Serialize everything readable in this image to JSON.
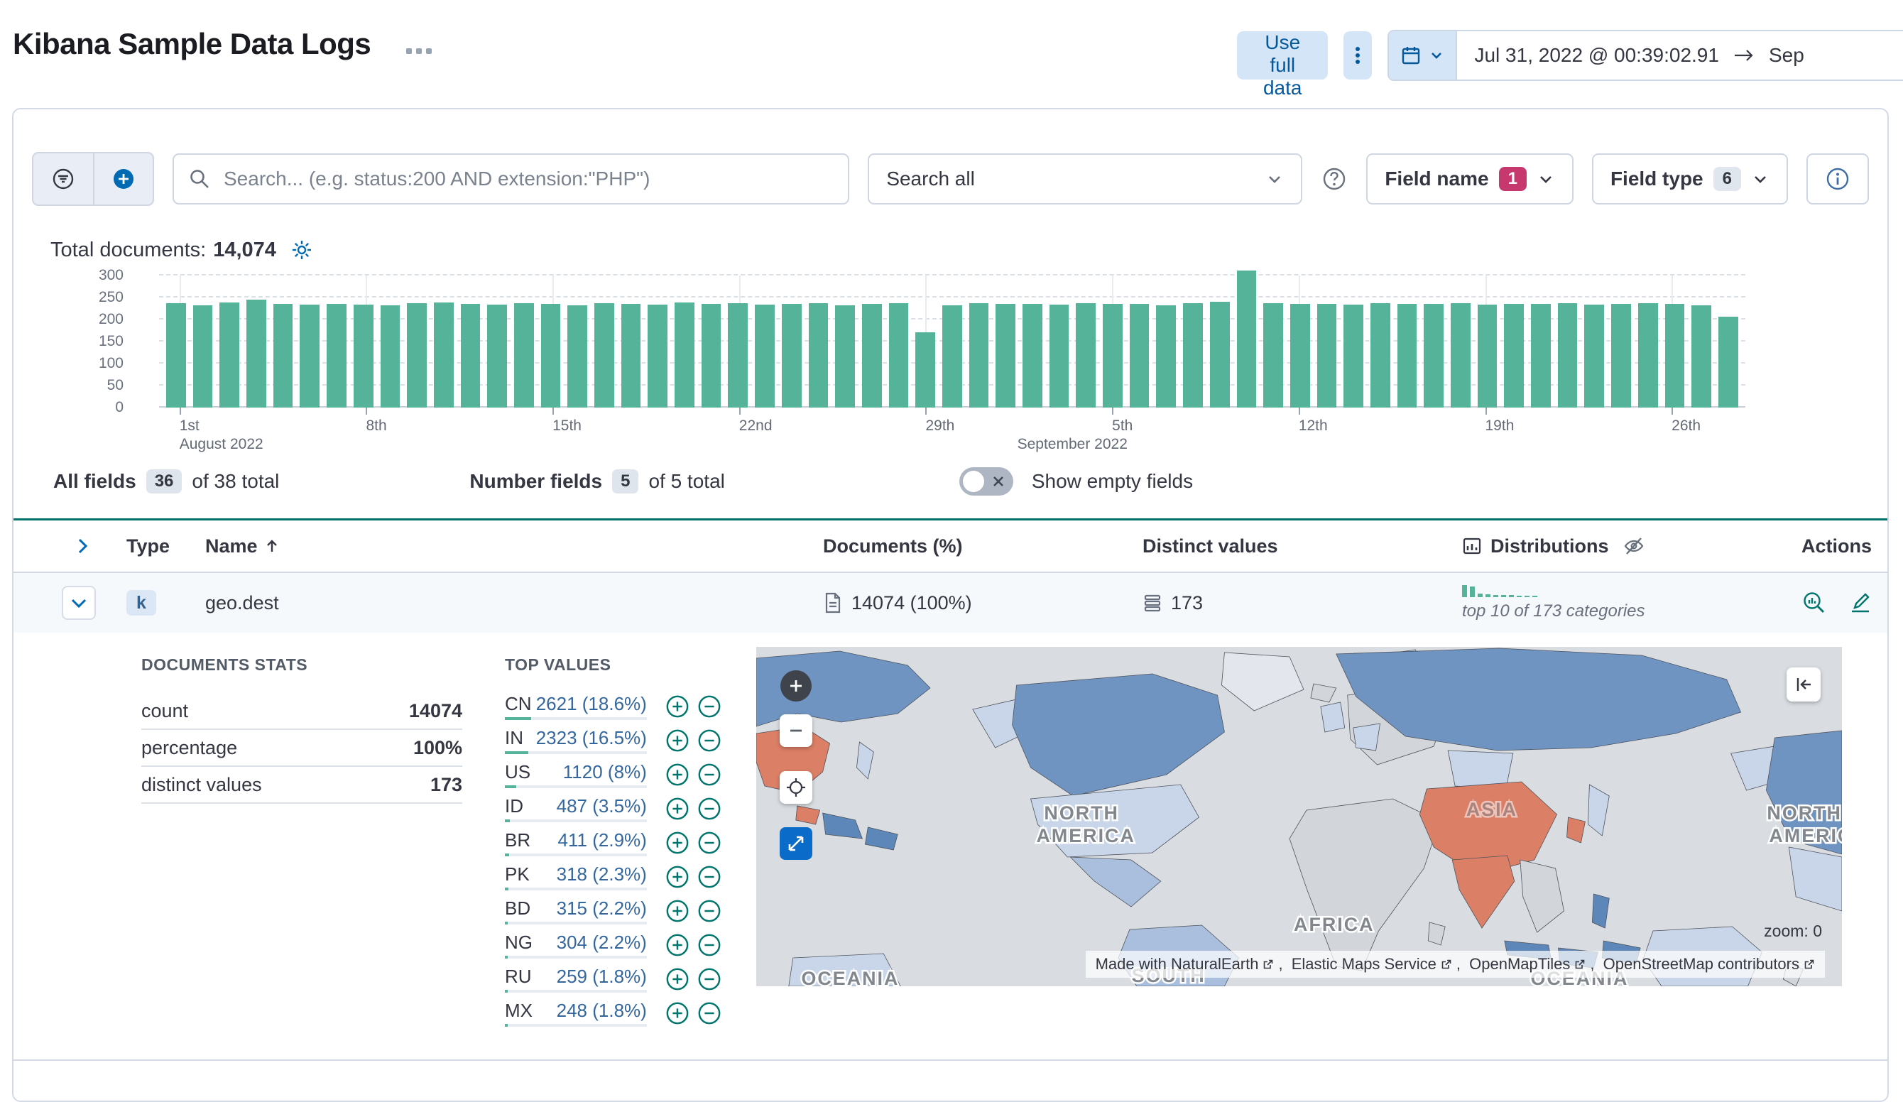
{
  "header": {
    "title": "Kibana Sample Data Logs",
    "use_full_data": "Use full data",
    "date_start": "Jul 31, 2022 @ 00:39:02.91",
    "date_end": "Sep"
  },
  "toolbar": {
    "search_placeholder": "Search... (e.g. status:200 AND extension:\"PHP\")",
    "search_all": "Search all",
    "field_name_label": "Field name",
    "field_name_count": "1",
    "field_type_label": "Field type",
    "field_type_count": "6"
  },
  "summary": {
    "total_documents_label": "Total documents:",
    "total_documents_value": "14,074"
  },
  "chart_data": {
    "type": "bar",
    "ylim": [
      0,
      300
    ],
    "yticks": [
      0,
      50,
      100,
      150,
      200,
      250,
      300
    ],
    "grid": true,
    "bar_color": "#54b399",
    "xticks": [
      {
        "i": 0,
        "label": "1st",
        "sub": "August 2022"
      },
      {
        "i": 7,
        "label": "8th"
      },
      {
        "i": 14,
        "label": "15th"
      },
      {
        "i": 21,
        "label": "22nd"
      },
      {
        "i": 28,
        "label": "29th"
      },
      {
        "i": 35,
        "label": "5th",
        "sub": "September 2022",
        "sub_align": "right"
      },
      {
        "i": 42,
        "label": "12th"
      },
      {
        "i": 49,
        "label": "19th"
      },
      {
        "i": 56,
        "label": "26th"
      }
    ],
    "values": [
      237,
      233,
      238,
      245,
      236,
      234,
      236,
      234,
      233,
      237,
      238,
      235,
      234,
      237,
      236,
      233,
      237,
      235,
      234,
      238,
      236,
      237,
      234,
      235,
      237,
      233,
      236,
      237,
      171,
      233,
      237,
      235,
      236,
      234,
      237,
      236,
      235,
      233,
      237,
      240,
      312,
      237,
      235,
      236,
      234,
      237,
      235,
      236,
      237,
      234,
      236,
      235,
      237,
      234,
      236,
      237,
      235,
      233,
      206
    ]
  },
  "fields_bar": {
    "all_fields_label": "All fields",
    "all_fields_count": "36",
    "all_fields_total": "of 38 total",
    "number_fields_label": "Number fields",
    "number_fields_count": "5",
    "number_fields_total": "of 5 total",
    "show_empty_label": "Show empty fields"
  },
  "table": {
    "headers": {
      "type": "Type",
      "name": "Name",
      "documents": "Documents (%)",
      "distinct_values": "Distinct values",
      "distributions": "Distributions",
      "actions": "Actions"
    },
    "row": {
      "type_token": "k",
      "name": "geo.dest",
      "documents": "14074 (100%)",
      "distinct_values": "173",
      "distribution_caption": "top 10 of 173 categories",
      "mini_bars": [
        17,
        15,
        5,
        4,
        3,
        3,
        3,
        2,
        2,
        2
      ]
    }
  },
  "details": {
    "stats_heading": "DOCUMENTS STATS",
    "stats_rows": [
      {
        "label": "count",
        "value": "14074"
      },
      {
        "label": "percentage",
        "value": "100%"
      },
      {
        "label": "distinct values",
        "value": "173"
      }
    ],
    "top_values_heading": "TOP VALUES",
    "top_values": [
      {
        "code": "CN",
        "value": "2621 (18.6%)",
        "pct": 18.6
      },
      {
        "code": "IN",
        "value": "2323 (16.5%)",
        "pct": 16.5
      },
      {
        "code": "US",
        "value": "1120 (8%)",
        "pct": 8
      },
      {
        "code": "ID",
        "value": "487 (3.5%)",
        "pct": 3.5
      },
      {
        "code": "BR",
        "value": "411 (2.9%)",
        "pct": 2.9
      },
      {
        "code": "PK",
        "value": "318 (2.3%)",
        "pct": 2.3
      },
      {
        "code": "BD",
        "value": "315 (2.2%)",
        "pct": 2.2
      },
      {
        "code": "NG",
        "value": "304 (2.2%)",
        "pct": 2.2
      },
      {
        "code": "RU",
        "value": "259 (1.8%)",
        "pct": 1.8
      },
      {
        "code": "MX",
        "value": "248 (1.8%)",
        "pct": 1.8
      }
    ],
    "map": {
      "zoom_label": "zoom: 0",
      "labels": {
        "north_1": "NORTH",
        "america_1": "AMERICA",
        "north_2": "NORTH",
        "america_2": "AMERICA",
        "africa": "AFRICA",
        "south": "SOUTH",
        "oceania_1": "OCEANIA",
        "oceania_2": "OCEANIA",
        "asia": "ASIA"
      },
      "attribution": [
        "Made with NaturalEarth",
        "Elastic Maps Service",
        "OpenMapTiles",
        "OpenStreetMap contributors"
      ]
    }
  }
}
